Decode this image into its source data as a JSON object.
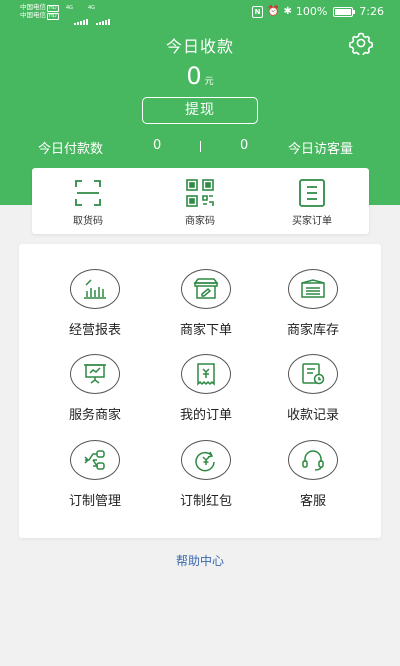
{
  "status_bar": {
    "carrier1": "中国电信",
    "carrier2": "中国电信",
    "hd": "HD",
    "net1": "4G",
    "net2": "4G",
    "battery": "100%",
    "time": "7:26",
    "icons": [
      "nfc-icon",
      "alarm-icon",
      "bluetooth-icon",
      "battery-icon"
    ]
  },
  "header": {
    "title": "今日收款",
    "amount": "0",
    "unit": "元",
    "withdraw": "提现",
    "settings_icon": "gear-icon",
    "bg_color": "#47b85f"
  },
  "stats": {
    "left_label": "今日付款数",
    "left_value": "0",
    "right_value": "0",
    "right_label": "今日访客量"
  },
  "quick": [
    {
      "label": "取货码",
      "icon": "scan-icon"
    },
    {
      "label": "商家码",
      "icon": "qrcode-icon"
    },
    {
      "label": "买家订单",
      "icon": "order-list-icon"
    }
  ],
  "grid": [
    {
      "label": "经营报表",
      "icon": "bar-chart-icon"
    },
    {
      "label": "商家下单",
      "icon": "shop-icon"
    },
    {
      "label": "商家库存",
      "icon": "inventory-icon"
    },
    {
      "label": "服务商家",
      "icon": "presentation-icon"
    },
    {
      "label": "我的订单",
      "icon": "receipt-icon"
    },
    {
      "label": "收款记录",
      "icon": "record-icon"
    },
    {
      "label": "订制管理",
      "icon": "flow-icon"
    },
    {
      "label": "订制红包",
      "icon": "red-packet-icon"
    },
    {
      "label": "客服",
      "icon": "headset-icon"
    }
  ],
  "help": "帮助中心"
}
